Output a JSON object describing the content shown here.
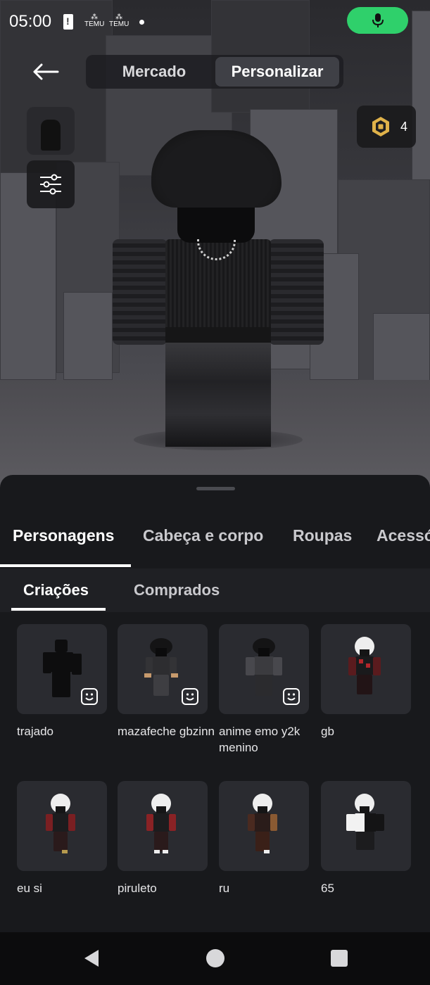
{
  "status_bar": {
    "time": "05:00",
    "notif_1": "TEMU",
    "notif_2": "TEMU",
    "icons": [
      "battery-alert-icon",
      "temu-icon",
      "temu-icon",
      "dot-icon",
      "microphone-icon"
    ]
  },
  "top_nav": {
    "tabs": [
      {
        "label": "Mercado",
        "active": false
      },
      {
        "label": "Personalizar",
        "active": true
      }
    ],
    "robux_count": "4"
  },
  "category_tabs": [
    {
      "label": "Personagens",
      "active": true
    },
    {
      "label": "Cabeça e corpo",
      "active": false
    },
    {
      "label": "Roupas",
      "active": false
    },
    {
      "label": "Acessó",
      "active": false
    }
  ],
  "sub_tabs": [
    {
      "label": "Criações",
      "active": true
    },
    {
      "label": "Comprados",
      "active": false
    }
  ],
  "items": [
    {
      "name": "trajado",
      "badge": true,
      "style": "silhouette"
    },
    {
      "name": "mazafeche gbzinn",
      "badge": true,
      "style": "dark-hair"
    },
    {
      "name": "anime emo y2k menino",
      "badge": true,
      "style": "dark-hair-grey"
    },
    {
      "name": "gb",
      "badge": false,
      "style": "white-hair-red"
    },
    {
      "name": "eu si",
      "badge": false,
      "style": "white-hair-red"
    },
    {
      "name": "piruleto",
      "badge": false,
      "style": "white-hair-red"
    },
    {
      "name": "ru",
      "badge": false,
      "style": "white-hair-brown"
    },
    {
      "name": "65",
      "badge": false,
      "style": "white-hair-bw"
    }
  ],
  "colors": {
    "mic_green": "#2fd06b",
    "sheet_bg": "#18191c",
    "card_bg": "#2a2b30",
    "robux_gold": "#e0b24a"
  }
}
